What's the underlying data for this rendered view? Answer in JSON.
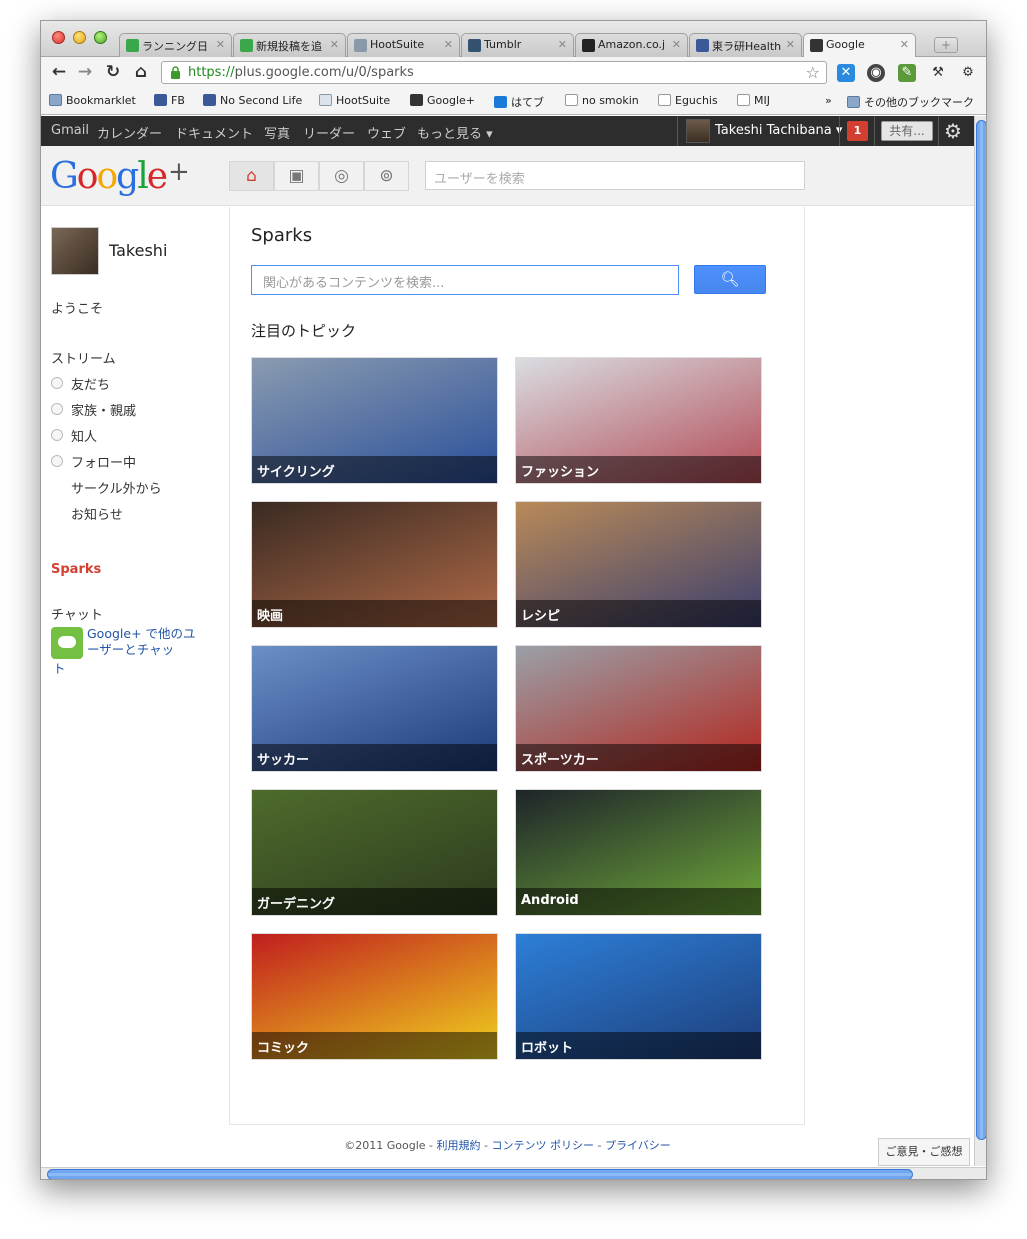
{
  "browser": {
    "tabs": [
      {
        "label": "ランニング日",
        "color": "#3aa84a"
      },
      {
        "label": "新規投稿を追",
        "color": "#3aa84a"
      },
      {
        "label": "HootSuite",
        "color": "#8a99aa"
      },
      {
        "label": "Tumblr",
        "color": "#34526f"
      },
      {
        "label": "Amazon.co.j",
        "color": "#222222"
      },
      {
        "label": "東ラ研Health",
        "color": "#3b5998"
      },
      {
        "label": "Google",
        "color": "#333333"
      }
    ],
    "url_scheme": "https://",
    "url_rest": "plus.google.com/u/0/sparks",
    "bookmarks": [
      {
        "label": "Bookmarklet",
        "icon": "folder"
      },
      {
        "label": "FB",
        "icon": "fb"
      },
      {
        "label": "No Second Life",
        "icon": "fb"
      },
      {
        "label": "HootSuite",
        "icon": "hs"
      },
      {
        "label": "Google+",
        "icon": "gp"
      },
      {
        "label": "はてブ",
        "icon": "hb"
      },
      {
        "label": "no smokin",
        "icon": "page"
      },
      {
        "label": "Eguchis",
        "icon": "page"
      },
      {
        "label": "MIJ",
        "icon": "page"
      }
    ],
    "bookmarks_more": "»",
    "other_bookmarks": "その他のブックマーク"
  },
  "gbar": {
    "links": [
      "Gmail",
      "カレンダー",
      "ドキュメント",
      "写真",
      "リーダー",
      "ウェブ",
      "もっと見る ▾"
    ],
    "user_name": "Takeshi Tachibana ▾",
    "notifications": "1",
    "share": "共有..."
  },
  "header": {
    "logo": [
      "G",
      "o",
      "o",
      "g",
      "l",
      "e",
      "+"
    ],
    "search_placeholder": "ユーザーを検索"
  },
  "sidebar": {
    "name": "Takeshi",
    "welcome": "ようこそ",
    "stream": "ストリーム",
    "circles": [
      "友だち",
      "家族・親戚",
      "知人",
      "フォロー中"
    ],
    "extra": [
      "サークル外から",
      "お知らせ"
    ],
    "sparks": "Sparks",
    "chat_label": "チャット",
    "chat_link": "Google+ で他のユーザーとチャッ",
    "chat_link_tail": "ト"
  },
  "main": {
    "title": "Sparks",
    "search_placeholder": "関心があるコンテンツを検索...",
    "topics_heading": "注目のトピック",
    "topics": [
      {
        "label": "サイクリング",
        "c1": "#8a9bb0",
        "c2": "#2a4f9a"
      },
      {
        "label": "ファッション",
        "c1": "#d9dde2",
        "c2": "#b24a55"
      },
      {
        "label": "映画",
        "c1": "#3a2a22",
        "c2": "#b06a48"
      },
      {
        "label": "レシピ",
        "c1": "#b98a58",
        "c2": "#3b3f6e"
      },
      {
        "label": "サッカー",
        "c1": "#6b8fc8",
        "c2": "#1e3a7a"
      },
      {
        "label": "スポーツカー",
        "c1": "#9aa0a8",
        "c2": "#b3261e"
      },
      {
        "label": "ガーデニング",
        "c1": "#4e6b2c",
        "c2": "#2c3a1e"
      },
      {
        "label": "Android",
        "c1": "#1e242a",
        "c2": "#6fa83a"
      },
      {
        "label": "コミック",
        "c1": "#c01e1e",
        "c2": "#f0d21e"
      },
      {
        "label": "ロボット",
        "c1": "#2d7fd8",
        "c2": "#1e3e7a"
      }
    ]
  },
  "footer": {
    "copyright": "©2011 Google - ",
    "links": [
      "利用規約",
      "コンテンツ ポリシー",
      "プライバシー"
    ]
  },
  "feedback": "ご意見・ご感想"
}
